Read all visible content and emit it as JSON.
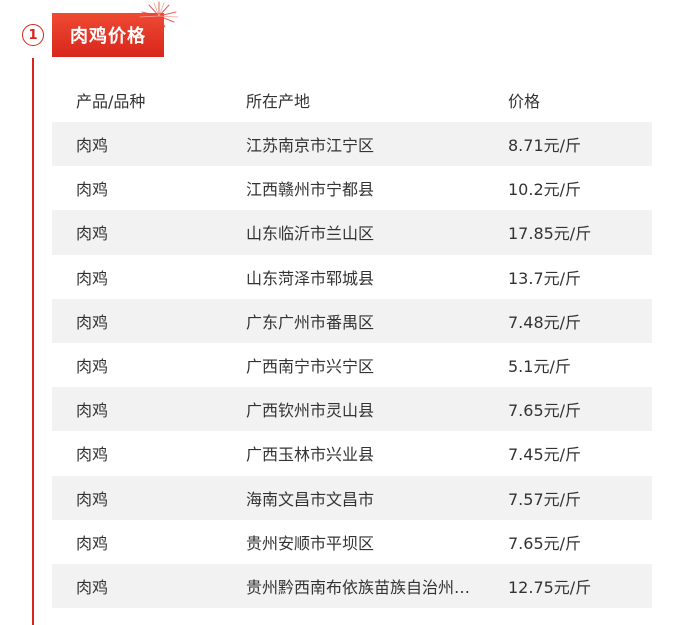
{
  "section": {
    "number": "1",
    "title": "肉鸡价格",
    "accent_color": "#d9251c"
  },
  "table": {
    "headers": [
      "产品/品种",
      "所在产地",
      "价格"
    ],
    "rows": [
      {
        "product": "肉鸡",
        "origin": "江苏南京市江宁区",
        "price": "8.71元/斤"
      },
      {
        "product": "肉鸡",
        "origin": "江西赣州市宁都县",
        "price": "10.2元/斤"
      },
      {
        "product": "肉鸡",
        "origin": "山东临沂市兰山区",
        "price": "17.85元/斤"
      },
      {
        "product": "肉鸡",
        "origin": "山东菏泽市郓城县",
        "price": "13.7元/斤"
      },
      {
        "product": "肉鸡",
        "origin": "广东广州市番禺区",
        "price": "7.48元/斤"
      },
      {
        "product": "肉鸡",
        "origin": "广西南宁市兴宁区",
        "price": "5.1元/斤"
      },
      {
        "product": "肉鸡",
        "origin": "广西钦州市灵山县",
        "price": "7.65元/斤"
      },
      {
        "product": "肉鸡",
        "origin": "广西玉林市兴业县",
        "price": "7.45元/斤"
      },
      {
        "product": "肉鸡",
        "origin": "海南文昌市文昌市",
        "price": "7.57元/斤"
      },
      {
        "product": "肉鸡",
        "origin": "贵州安顺市平坝区",
        "price": "7.65元/斤"
      },
      {
        "product": "肉鸡",
        "origin": "贵州黔西南布依族苗族自治州兴…",
        "price": "12.75元/斤"
      }
    ]
  }
}
